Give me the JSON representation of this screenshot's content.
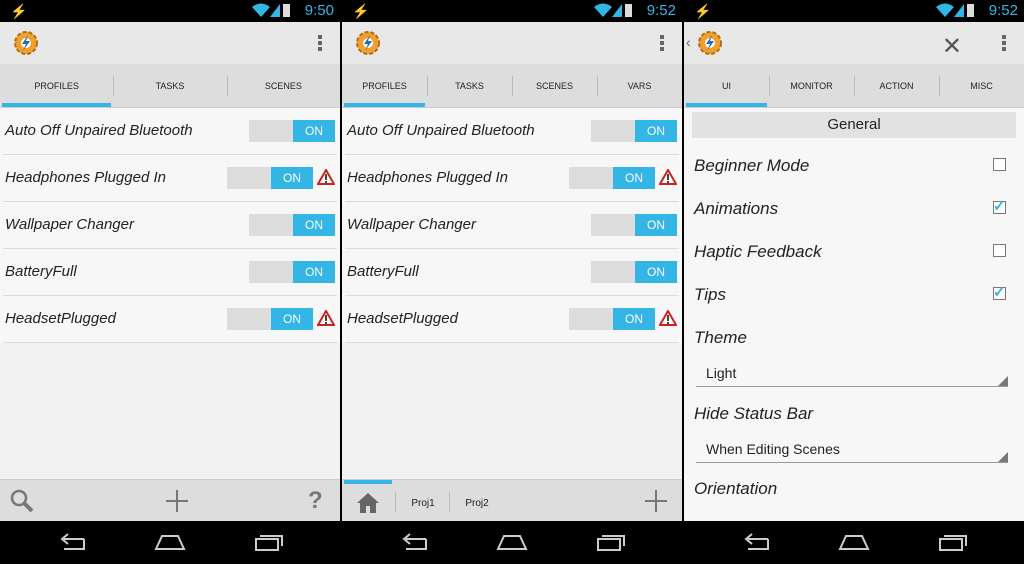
{
  "status": {
    "time1": "9:50",
    "time2": "9:52",
    "time3": "9:52"
  },
  "panel1": {
    "tabs": [
      {
        "label": "PROFILES"
      },
      {
        "label": "TASKS"
      },
      {
        "label": "SCENES"
      }
    ],
    "profiles": [
      {
        "name": "Auto Off Unpaired Bluetooth",
        "state": "ON",
        "warning": false
      },
      {
        "name": "Headphones Plugged In",
        "state": "ON",
        "warning": true
      },
      {
        "name": "Wallpaper Changer",
        "state": "ON",
        "warning": false
      },
      {
        "name": "BatteryFull",
        "state": "ON",
        "warning": false
      },
      {
        "name": "HeadsetPlugged",
        "state": "ON",
        "warning": true
      }
    ]
  },
  "panel2": {
    "tabs": [
      {
        "label": "PROFILES"
      },
      {
        "label": "TASKS"
      },
      {
        "label": "SCENES"
      },
      {
        "label": "VARS"
      }
    ],
    "profiles": [
      {
        "name": "Auto Off Unpaired Bluetooth",
        "state": "ON",
        "warning": false
      },
      {
        "name": "Headphones Plugged In",
        "state": "ON",
        "warning": true
      },
      {
        "name": "Wallpaper Changer",
        "state": "ON",
        "warning": false
      },
      {
        "name": "BatteryFull",
        "state": "ON",
        "warning": false
      },
      {
        "name": "HeadsetPlugged",
        "state": "ON",
        "warning": true
      }
    ],
    "projects": [
      "Proj1",
      "Proj2"
    ]
  },
  "panel3": {
    "tabs": [
      {
        "label": "UI"
      },
      {
        "label": "MONITOR"
      },
      {
        "label": "ACTION"
      },
      {
        "label": "MISC"
      }
    ],
    "section": "General",
    "prefs": {
      "beginner": {
        "label": "Beginner Mode",
        "checked": false
      },
      "animations": {
        "label": "Animations",
        "checked": true
      },
      "haptic": {
        "label": "Haptic Feedback",
        "checked": false
      },
      "tips": {
        "label": "Tips",
        "checked": true
      },
      "theme": {
        "label": "Theme",
        "value": "Light"
      },
      "hide_status": {
        "label": "Hide Status Bar",
        "value": "When Editing Scenes"
      },
      "orientation": {
        "label": "Orientation"
      }
    }
  },
  "colors": {
    "accent": "#33b5e5",
    "warning": "#cc2222"
  }
}
